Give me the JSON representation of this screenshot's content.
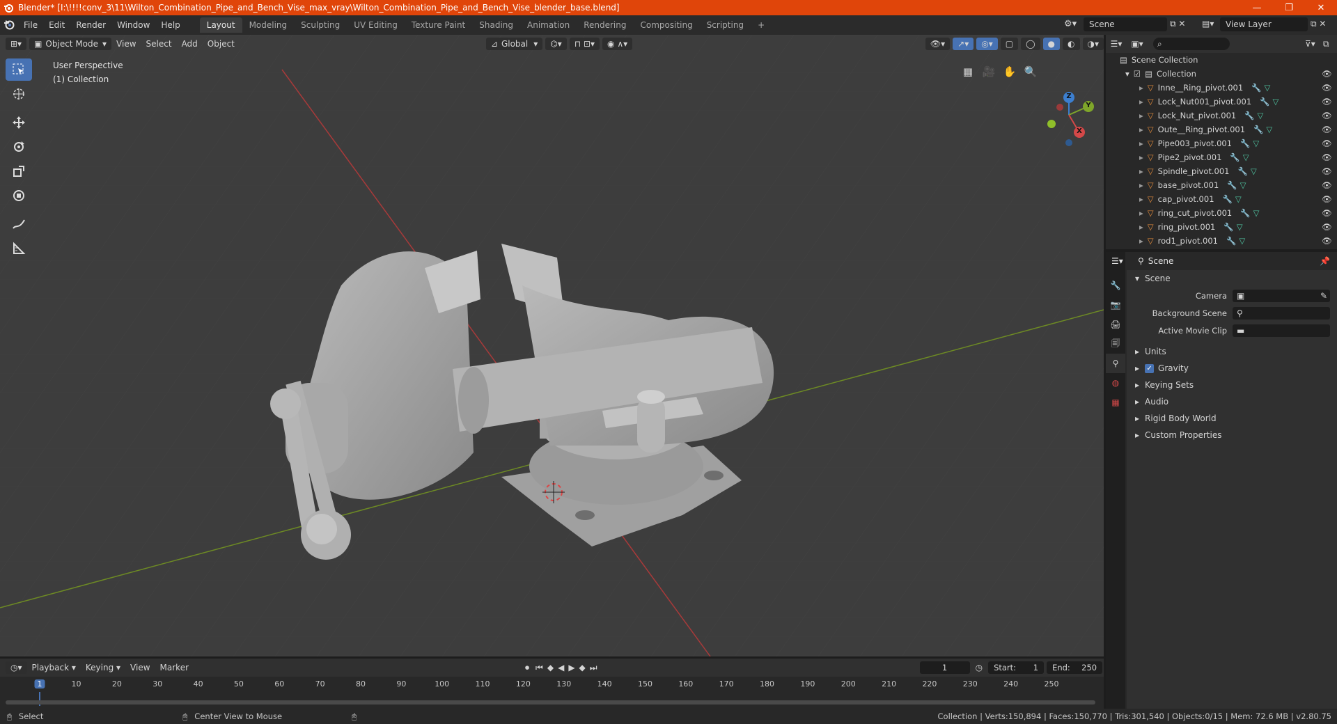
{
  "window": {
    "title": "Blender* [I:\\!!!!conv_3\\11\\Wilton_Combination_Pipe_and_Bench_Vise_max_vray\\Wilton_Combination_Pipe_and_Bench_Vise_blender_base.blend]",
    "minimize": "—",
    "maximize": "❐",
    "close": "✕"
  },
  "menu": [
    "File",
    "Edit",
    "Render",
    "Window",
    "Help"
  ],
  "workspaces": [
    "Layout",
    "Modeling",
    "Sculpting",
    "UV Editing",
    "Texture Paint",
    "Shading",
    "Animation",
    "Rendering",
    "Compositing",
    "Scripting"
  ],
  "active_workspace": "Layout",
  "add_workspace": "+",
  "scene": {
    "name": "Scene",
    "view_layer": "View Layer"
  },
  "viewport": {
    "mode": "Object Mode",
    "menus": [
      "View",
      "Select",
      "Add",
      "Object"
    ],
    "orientation": "Global",
    "info_line1": "User Perspective",
    "info_line2": "(1) Collection",
    "gizmo": {
      "z": "Z",
      "y": "Y",
      "x": "X"
    }
  },
  "outliner": {
    "root": "Scene Collection",
    "collection": "Collection",
    "items": [
      "Inne__Ring_pivot.001",
      "Lock_Nut001_pivot.001",
      "Lock_Nut_pivot.001",
      "Oute__Ring_pivot.001",
      "Pipe003_pivot.001",
      "Pipe2_pivot.001",
      "Spindle_pivot.001",
      "base_pivot.001",
      "cap_pivot.001",
      "ring_cut_pivot.001",
      "ring_pivot.001",
      "rod1_pivot.001"
    ]
  },
  "properties": {
    "header": "Scene",
    "panel": "Scene",
    "camera_label": "Camera",
    "background_label": "Background Scene",
    "movie_clip_label": "Active Movie Clip",
    "sections": [
      "Units",
      "Gravity",
      "Keying Sets",
      "Audio",
      "Rigid Body World",
      "Custom Properties"
    ],
    "gravity_checked": true
  },
  "timeline": {
    "menus": [
      "Playback",
      "Keying",
      "View",
      "Marker"
    ],
    "current_frame": "1",
    "start_label": "Start:",
    "start": "1",
    "end_label": "End:",
    "end": "250",
    "ticks": [
      "1",
      "10",
      "20",
      "30",
      "40",
      "50",
      "60",
      "70",
      "80",
      "90",
      "100",
      "110",
      "120",
      "130",
      "140",
      "150",
      "160",
      "170",
      "180",
      "190",
      "200",
      "210",
      "220",
      "230",
      "240",
      "250"
    ]
  },
  "statusbar": {
    "select": "Select",
    "center": "Center View to Mouse",
    "stats": "Collection | Verts:150,894 | Faces:150,770 | Tris:301,540 | Objects:0/15 | Mem: 72.6 MB | v2.80.75"
  },
  "colors": {
    "titlebar": "#e0450a",
    "accent": "#4772b3",
    "x_axis": "#c0392b",
    "y_axis": "#7fa62a",
    "mesh_icon": "#4fc3a1",
    "object_icon": "#e08a3c"
  }
}
